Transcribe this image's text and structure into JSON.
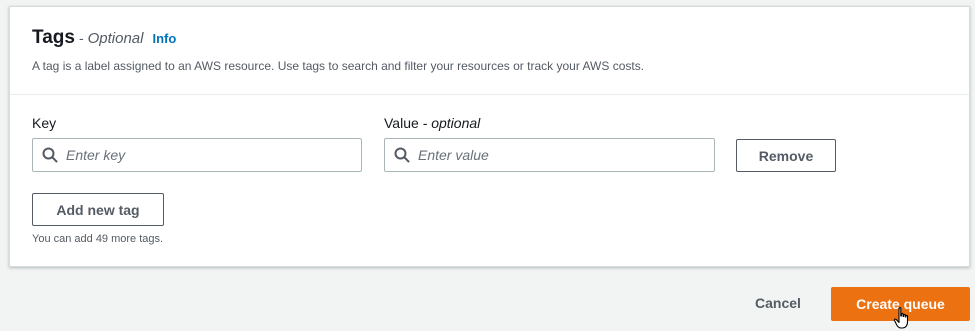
{
  "tags_panel": {
    "title": "Tags",
    "separator": "-",
    "optional_label": "Optional",
    "info_link": "Info",
    "description": "A tag is a label assigned to an AWS resource. Use tags to search and filter your resources or track your AWS costs.",
    "key_field": {
      "label": "Key",
      "placeholder": "Enter key",
      "value": ""
    },
    "value_field": {
      "label": "Value",
      "label_suffix": "- optional",
      "placeholder": "Enter value",
      "value": ""
    },
    "remove_button": "Remove",
    "add_tag_button": "Add new tag",
    "remaining_hint": "You can add 49 more tags.",
    "icons": {
      "key_input_icon": "search-icon",
      "value_input_icon": "search-icon"
    }
  },
  "footer": {
    "cancel_label": "Cancel",
    "create_label": "Create queue",
    "cursor_icon": "hand-pointer-icon"
  },
  "colors": {
    "primary_button": "#ec7211",
    "link": "#0073bb",
    "page_background": "#f2f3f3"
  }
}
